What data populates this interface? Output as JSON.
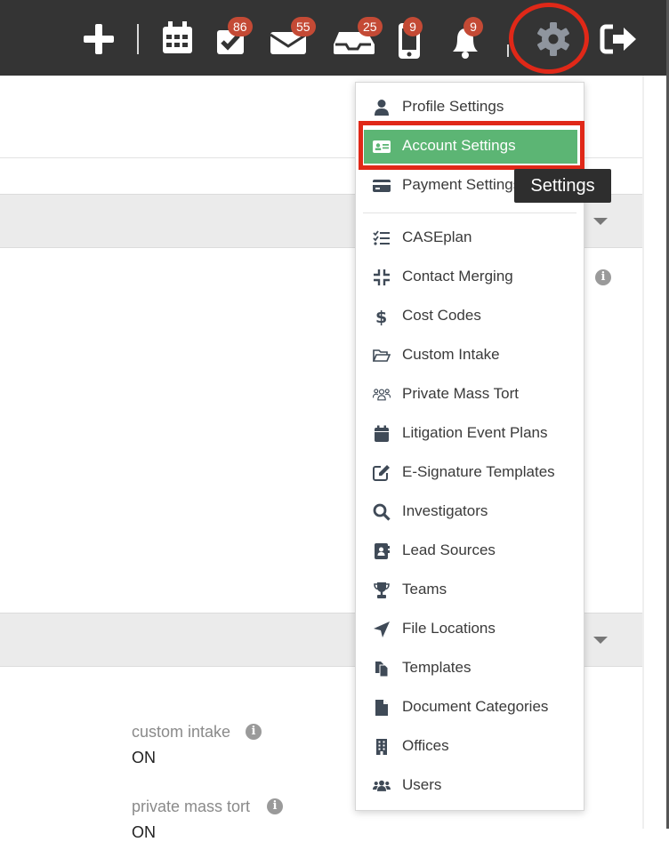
{
  "topbar": {
    "badges": {
      "tasks": "86",
      "mail": "55",
      "inbox": "25",
      "phone": "9",
      "notifications": "9"
    }
  },
  "settings_menu": {
    "items": [
      {
        "label": "Profile Settings",
        "icon": "user-icon"
      },
      {
        "label": "Account Settings",
        "icon": "id-card-icon"
      },
      {
        "label": "Payment Settings",
        "icon": "credit-card-icon"
      },
      {
        "label": "CASEplan",
        "icon": "task-list-icon"
      },
      {
        "label": "Contact Merging",
        "icon": "compress-icon"
      },
      {
        "label": "Cost Codes",
        "icon": "dollar-icon"
      },
      {
        "label": "Custom Intake",
        "icon": "folder-open-icon"
      },
      {
        "label": "Private Mass Tort",
        "icon": "group-icon"
      },
      {
        "label": "Litigation Event Plans",
        "icon": "calendar-icon"
      },
      {
        "label": "E-Signature Templates",
        "icon": "edit-icon"
      },
      {
        "label": "Investigators",
        "icon": "search-icon"
      },
      {
        "label": "Lead Sources",
        "icon": "address-book-icon"
      },
      {
        "label": "Teams",
        "icon": "trophy-icon"
      },
      {
        "label": "File Locations",
        "icon": "location-arrow-icon"
      },
      {
        "label": "Templates",
        "icon": "copy-icon"
      },
      {
        "label": "Document Categories",
        "icon": "file-icon"
      },
      {
        "label": "Offices",
        "icon": "building-icon"
      },
      {
        "label": "Users",
        "icon": "users-icon"
      }
    ],
    "active_index": 1
  },
  "tooltip": {
    "text": "Settings"
  },
  "fields": [
    {
      "label": "custom intake",
      "value": "ON"
    },
    {
      "label": "private mass tort",
      "value": "ON"
    }
  ],
  "colors": {
    "topbar": "#343434",
    "active_item": "#5cb574",
    "badge": "#c44a35",
    "highlight_outline": "#e02818"
  }
}
